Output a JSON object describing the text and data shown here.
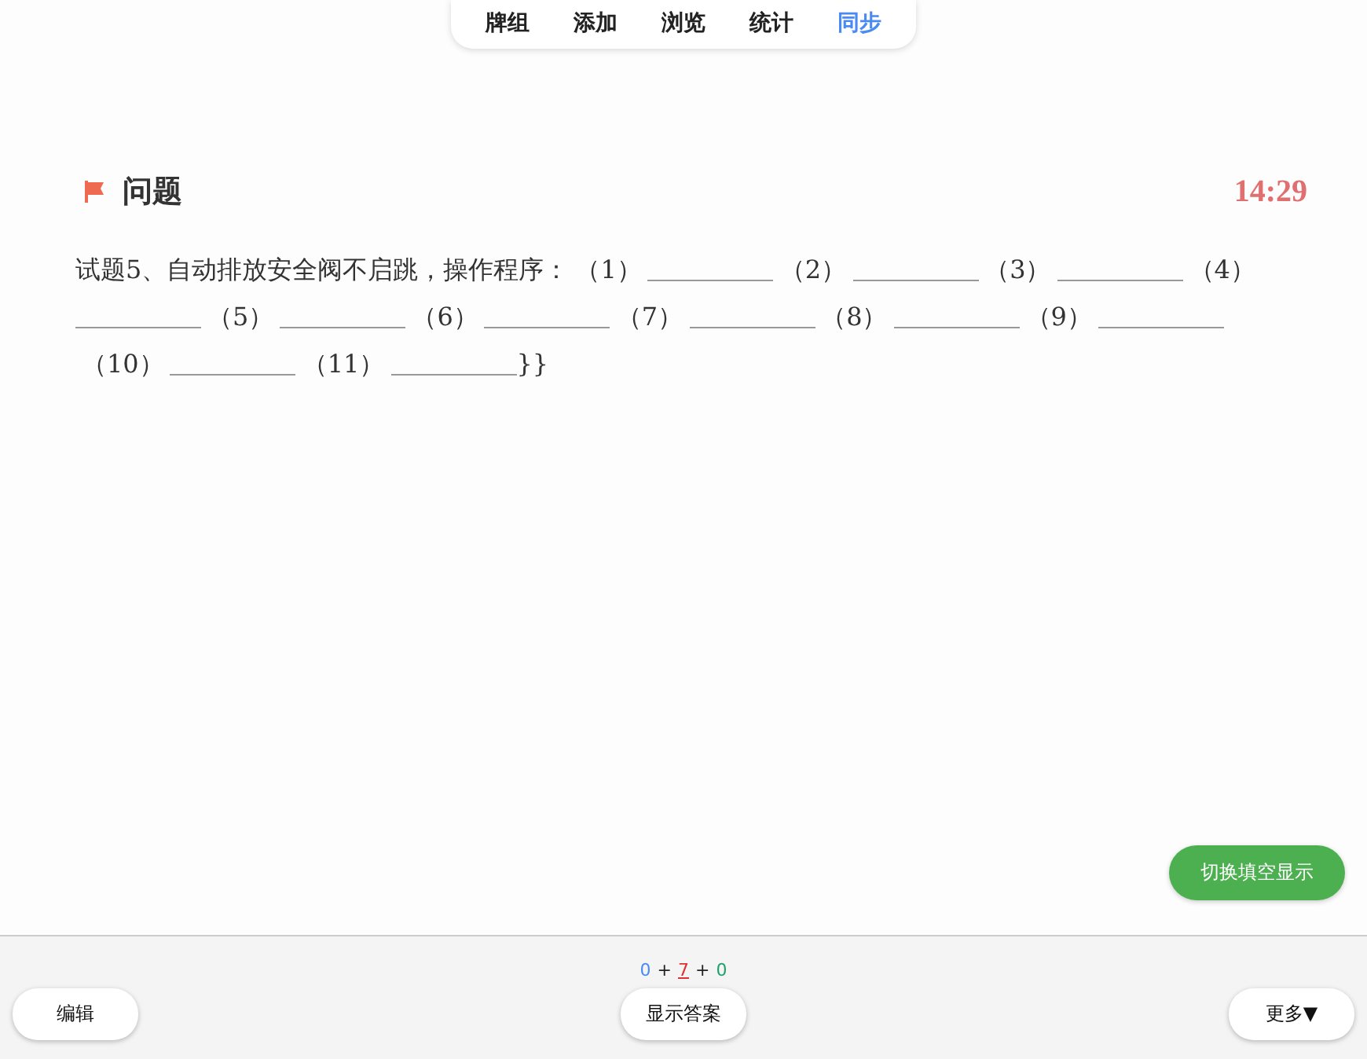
{
  "tabs": [
    {
      "label": "牌组",
      "selected": false
    },
    {
      "label": "添加",
      "selected": false
    },
    {
      "label": "浏览",
      "selected": false
    },
    {
      "label": "统计",
      "selected": false
    },
    {
      "label": "同步",
      "selected": true
    }
  ],
  "question": {
    "heading": "问题",
    "timer": "14:29",
    "prompt": "试题5、自动排放安全阀不启跳，操作程序：",
    "blanks": [
      "（1）",
      "（2）",
      "（3）",
      "（4）",
      "（5）",
      "（6）",
      "（7）",
      "（8）",
      "（9）",
      "（10）",
      "（11）"
    ],
    "suffix": "}}"
  },
  "toggle_button": "切换填空显示",
  "counts": [
    {
      "text": "0",
      "color": "#4a8af4",
      "underlined": false
    },
    {
      "text": "+",
      "color": "#222222",
      "underlined": false
    },
    {
      "text": "7",
      "color": "#e03030",
      "underlined": true
    },
    {
      "text": "+",
      "color": "#222222",
      "underlined": false
    },
    {
      "text": "0",
      "color": "#22a06b",
      "underlined": false
    }
  ],
  "bottom": {
    "edit": "编辑",
    "show_answer": "显示答案",
    "more": "更多▼"
  }
}
